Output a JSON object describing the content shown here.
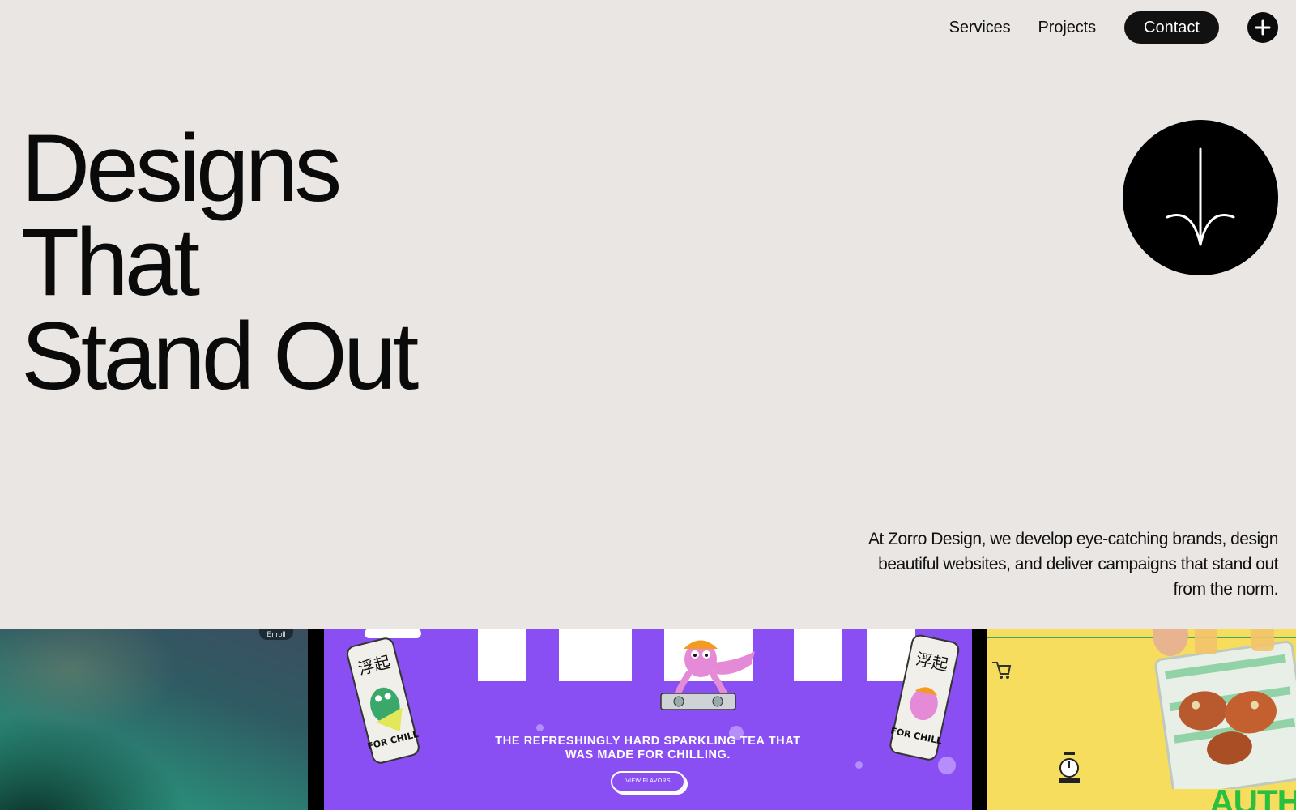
{
  "nav": {
    "services": "Services",
    "projects": "Projects",
    "contact": "Contact"
  },
  "hero": {
    "line1": "Designs",
    "line2": "That",
    "line3": "Stand Out"
  },
  "tagline": "At Zorro Design, we develop eye-catching brands, design beautiful websites, and deliver campaigns that stand out from the norm.",
  "projects": {
    "card1": {
      "button": "Enroll"
    },
    "card2": {
      "can_chars": "浮起",
      "can_text": "FOR CHILL",
      "headline": "THE REFRESHINGLY HARD SPARKLING TEA THAT WAS MADE FOR CHILLING.",
      "button": "VIEW FLAVORS"
    },
    "card3": {
      "headline": "AUTH"
    }
  },
  "icons": {
    "plus": "plus-icon",
    "scroll": "arrow-down-icon"
  },
  "colors": {
    "background": "#e9e6e3",
    "dark": "#0b0b0b",
    "purple": "#8a4ff2",
    "yellow": "#f6dd5e",
    "green": "#2bbf3f"
  }
}
